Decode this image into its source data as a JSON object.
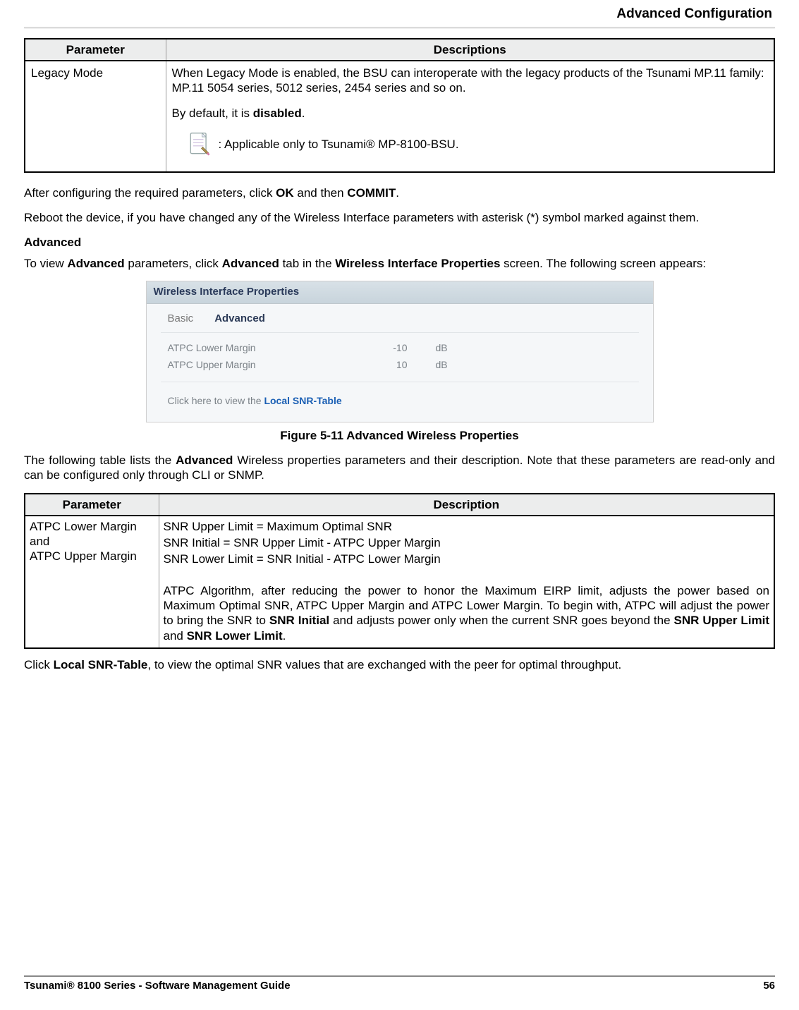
{
  "header": {
    "title": "Advanced Configuration"
  },
  "table1": {
    "headers": [
      "Parameter",
      "Descriptions"
    ],
    "row": {
      "param": "Legacy Mode",
      "desc_intro": "When Legacy Mode is enabled, the BSU can interoperate with the legacy products of the Tsunami MP.11 family: MP.11 5054 series, 5012 series, 2454 series and so on.",
      "default_prefix": "By default, it is ",
      "default_value": "disabled",
      "default_suffix": ".",
      "note": ": Applicable only to Tsunami® MP-8100-BSU."
    }
  },
  "para1": {
    "prefix": "After configuring the required parameters, click ",
    "ok": "OK",
    "mid": " and then ",
    "commit": "COMMIT",
    "suffix": "."
  },
  "para2": "Reboot the device, if you have changed any of the Wireless Interface parameters with asterisk (*) symbol marked against them.",
  "section": {
    "title": "Advanced"
  },
  "para3": {
    "p1": "To view ",
    "b1": "Advanced",
    "p2": " parameters, click ",
    "b2": "Advanced",
    "p3": " tab in the ",
    "b3": "Wireless Interface Properties",
    "p4": " screen. The following screen appears:"
  },
  "panel": {
    "title": "Wireless Interface Properties",
    "tabs": {
      "basic": "Basic",
      "advanced": "Advanced"
    },
    "rows": [
      {
        "label": "ATPC Lower Margin",
        "value": "-10",
        "unit": "dB"
      },
      {
        "label": "ATPC Upper Margin",
        "value": "10",
        "unit": "dB"
      }
    ],
    "foot_prefix": "Click here to view the ",
    "foot_link": "Local SNR-Table"
  },
  "figure_caption": "Figure 5-11 Advanced Wireless Properties",
  "para4": {
    "p1": "The following table lists the ",
    "b1": "Advanced",
    "p2": " Wireless properties parameters and their description. Note that these parameters are read-only and can be configured only through CLI or SNMP."
  },
  "table2": {
    "headers": [
      "Parameter",
      "Description"
    ],
    "row": {
      "param_l1": "ATPC Lower Margin",
      "param_l2": "and",
      "param_l3": "ATPC Upper Margin",
      "d1": "SNR Upper Limit = Maximum Optimal SNR",
      "d2": "SNR Initial = SNR Upper Limit - ATPC Upper Margin",
      "d3": "SNR Lower Limit = SNR Initial - ATPC Lower Margin",
      "d4_p1": "ATPC Algorithm, after reducing the power to honor the Maximum EIRP limit, adjusts the power based on Maximum Optimal SNR, ATPC Upper Margin and ATPC Lower Margin. To begin with, ATPC will adjust the power to bring the SNR to ",
      "d4_b1": "SNR Initial",
      "d4_p2": " and adjusts power only when the current SNR goes beyond the ",
      "d4_b2": "SNR Upper Limit",
      "d4_p3": " and ",
      "d4_b3": "SNR Lower Limit",
      "d4_p4": "."
    }
  },
  "para5": {
    "p1": "Click ",
    "b1": "Local SNR-Table",
    "p2": ", to view the optimal SNR values that are exchanged with the peer for optimal throughput."
  },
  "footer": {
    "left": "Tsunami® 8100 Series - Software Management Guide",
    "right": "56"
  }
}
